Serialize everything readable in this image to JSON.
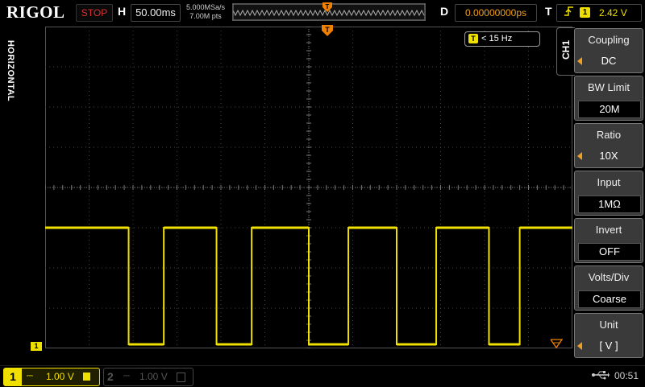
{
  "header": {
    "brand": "RIGOL",
    "run_state": "STOP",
    "run_state_color": "#e03030",
    "h_label": "H",
    "timebase": "50.00ms",
    "sample_rate": "5.000MSa/s",
    "mem_depth": "7.00M pts",
    "d_label": "D",
    "delay": "0.00000000ps",
    "t_label": "T",
    "trigger_source": "1",
    "trigger_level": "2.42 V"
  },
  "side_label": "HORIZONTAL",
  "display": {
    "freq_channel": "T",
    "freq_readout": "< 15 Hz",
    "ch1_marker": "1",
    "trace_color": "#f0e000",
    "waveform": {
      "type": "square",
      "high_div": -1.0,
      "low_div": -3.9,
      "edges_div": [
        -4.1,
        -3.3,
        -2.1,
        -1.3,
        0.0,
        0.9,
        2.0,
        2.9,
        4.1,
        4.8
      ]
    }
  },
  "menu": {
    "channel_tab": "CH1",
    "items": [
      {
        "title": "Coupling",
        "value": "DC",
        "arrow": true
      },
      {
        "title": "BW Limit",
        "value": "20M",
        "arrow": false
      },
      {
        "title": "Ratio",
        "value": "10X",
        "arrow": true
      },
      {
        "title": "Input",
        "value": "1MΩ",
        "arrow": false
      },
      {
        "title": "Invert",
        "value": "OFF",
        "arrow": false
      },
      {
        "title": "Volts/Div",
        "value": "Coarse",
        "arrow": false
      },
      {
        "title": "Unit",
        "value": "[  V  ]",
        "arrow": true
      }
    ]
  },
  "footer": {
    "ch1": {
      "num": "1",
      "coupling_symbol": "⎓",
      "scale": "1.00 V"
    },
    "ch2": {
      "num": "2",
      "coupling_symbol": "⎓",
      "scale": "1.00 V"
    },
    "usb_icon": "usb-icon",
    "time": "00:51"
  }
}
